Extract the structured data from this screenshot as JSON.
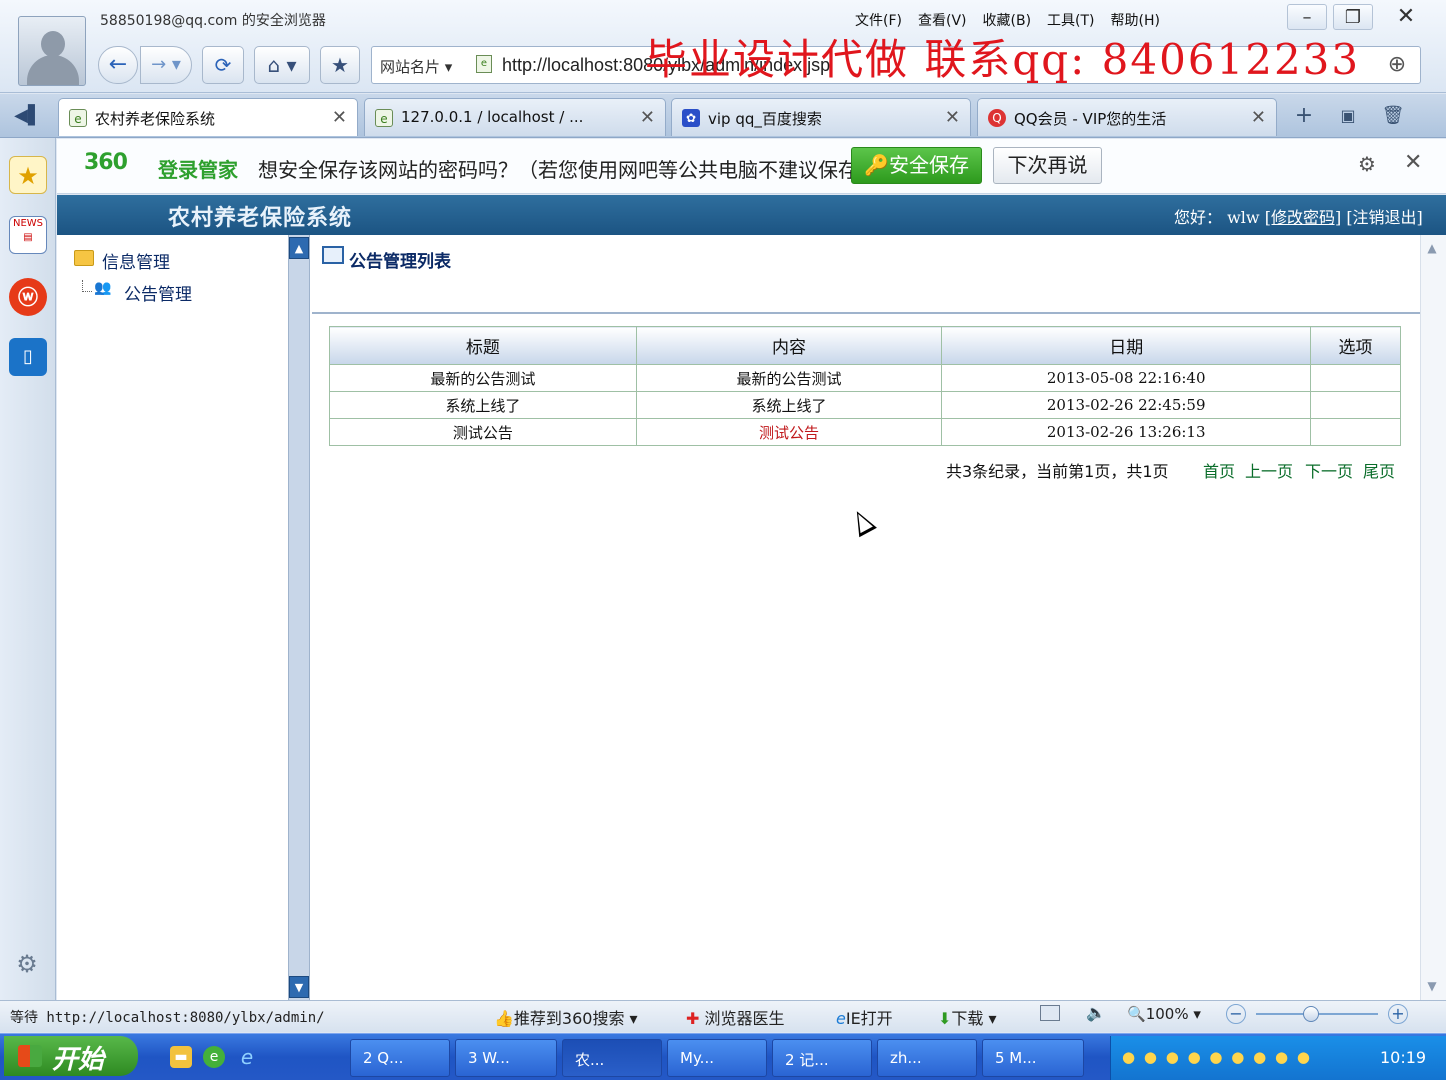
{
  "browser": {
    "user_title": "58850198@qq.com 的安全浏览器",
    "menu": [
      "文件(F)",
      "查看(V)",
      "收藏(B)",
      "工具(T)",
      "帮助(H)"
    ],
    "site_card": "网站名片",
    "url": "http://localhost:8080/ylbx/admin/index.jsp",
    "watermark": "毕业设计代做 联系qq: 840612233",
    "tabs": [
      {
        "label": "农村养老保险系统"
      },
      {
        "label": "127.0.0.1 / localhost / ..."
      },
      {
        "label": "vip qq_百度搜索"
      },
      {
        "label": "QQ会员 - VIP您的生活"
      }
    ]
  },
  "password_bar": {
    "logo": "360",
    "logo_text": "登录管家",
    "message": "想安全保存该网站的密码吗？（若您使用网吧等公共电脑不建议保存）",
    "save_label": "安全保存",
    "later_label": "下次再说"
  },
  "app": {
    "title": "农村养老保险系统",
    "greeting": "您好：",
    "username": "wlw",
    "change_password": "[修改密码]",
    "logout": "[注销退出]"
  },
  "tree": {
    "root": "信息管理",
    "child": "公告管理"
  },
  "content": {
    "title": "公告管理列表",
    "columns": [
      "标题",
      "内容",
      "日期",
      "选项"
    ],
    "rows": [
      {
        "title": "最新的公告测试",
        "content": "最新的公告测试",
        "date": "2013-05-08 22:16:40",
        "option": ""
      },
      {
        "title": "系统上线了",
        "content": "系统上线了",
        "date": "2013-02-26 22:45:59",
        "option": ""
      },
      {
        "title": "测试公告",
        "content": "测试公告",
        "date": "2013-02-26 13:26:13",
        "option": ""
      }
    ],
    "pager_info": "共3条纪录，当前第1页，共1页",
    "pager": {
      "first": "首页",
      "prev": "上一页",
      "next": "下一页",
      "last": "尾页"
    }
  },
  "statusbar": {
    "text": "等待 http://localhost:8080/ylbx/admin/",
    "recommend": "推荐到360搜索",
    "doctor": "浏览器医生",
    "ie_open": "IE打开",
    "download": "下载",
    "zoom": "100%",
    "zoom_level": 0.45
  },
  "taskbar": {
    "start": "开始",
    "tasks": [
      "2 Q...",
      "3 W...",
      "农...",
      "My...",
      "2 记...",
      "zh...",
      "5 M..."
    ],
    "clock": "10:19"
  }
}
